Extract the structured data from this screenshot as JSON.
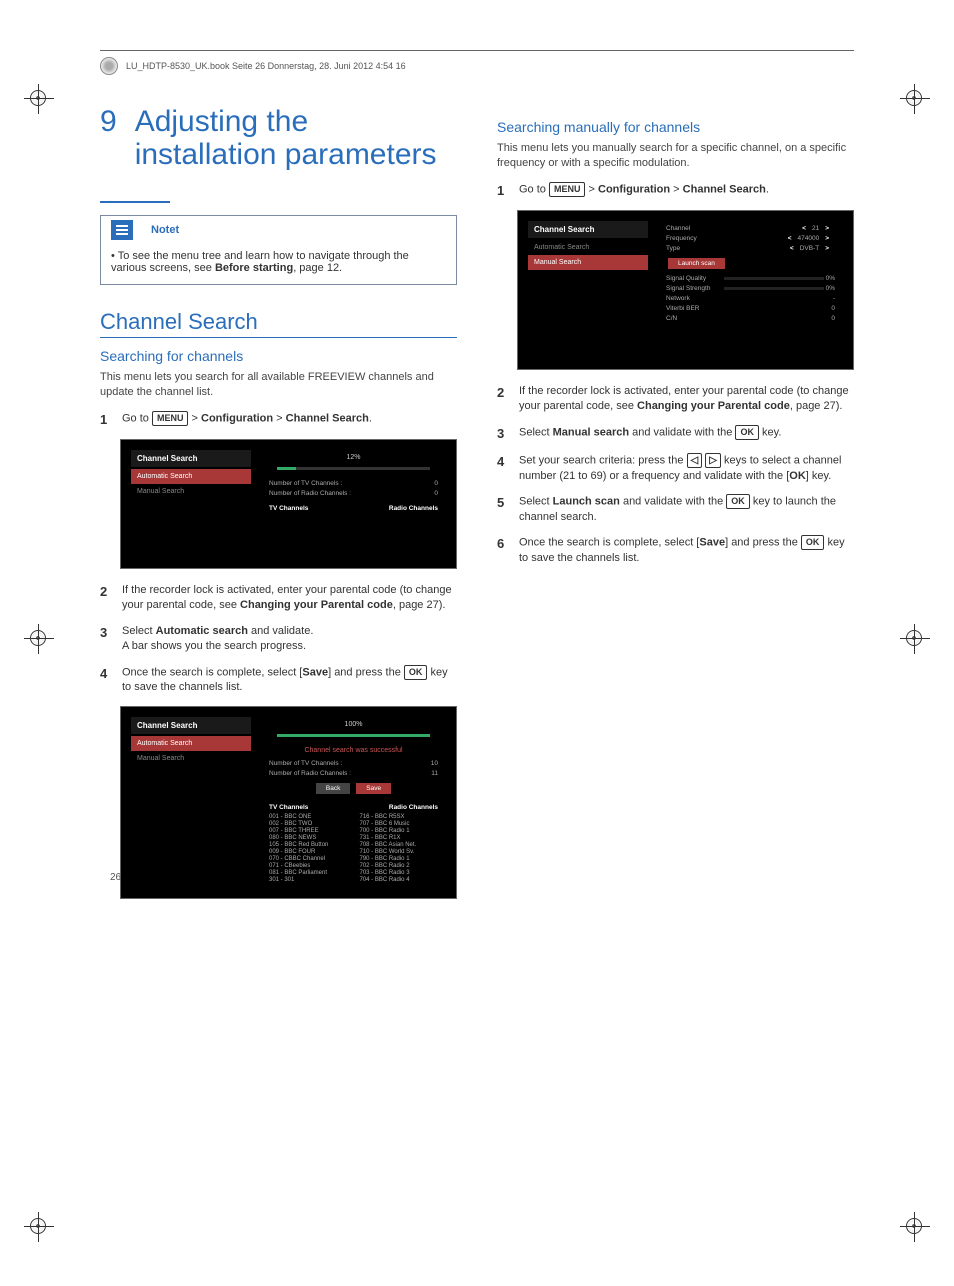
{
  "header": {
    "file_info": "LU_HDTP-8530_UK.book  Seite 26  Donnerstag, 28. Juni 2012  4:54 16"
  },
  "chapter": {
    "number": "9",
    "title": "Adjusting the installation parameters"
  },
  "note": {
    "label": "Notet",
    "text_pre": "• To see the menu tree and learn how to navigate through the various screens, see ",
    "text_bold": "Before starting",
    "text_post": ", page 12."
  },
  "left": {
    "h2": "Channel Search",
    "h3": "Searching for channels",
    "intro": "This menu lets you search for all available FREEVIEW channels and update the channel list.",
    "step1_pre": "Go to ",
    "menu": "MENU",
    "step1_mid": " > ",
    "step1_b1": "Configuration",
    "step1_mid2": " > ",
    "step1_b2": "Channel Search",
    "step1_end": ".",
    "step2_pre": "If the recorder lock is activated, enter your parental code (to change your parental code, see ",
    "step2_bold": "Changing your Parental code",
    "step2_post": ", page 27).",
    "step3_pre": "Select ",
    "step3_bold": "Automatic search",
    "step3_post": " and validate.",
    "step3_line2": "A bar shows you the search progress.",
    "step4_pre": "Once the search is complete, select [",
    "step4_bold": "Save",
    "step4_post": "] and press the ",
    "ok": "OK",
    "step4_end": " key to save the channels list."
  },
  "right": {
    "h3": "Searching manually for channels",
    "intro": "This menu lets you manually search for a specific channel, on a specific frequency or with a specific modulation.",
    "step1_pre": "Go to ",
    "menu": "MENU",
    "step1_mid": " > ",
    "step1_b1": "Configuration",
    "step1_mid2": " > ",
    "step1_b2": "Channel Search",
    "step1_end": ".",
    "step2_pre": "If the recorder lock is activated, enter your parental code (to change your parental code, see ",
    "step2_bold": "Changing your Parental code",
    "step2_post": ", page 27).",
    "step3_pre": "Select ",
    "step3_bold": "Manual search",
    "step3_post": " and validate with the ",
    "ok": "OK",
    "step3_end": " key.",
    "step4_pre": "Set your search criteria: press the ",
    "left_key": "◁",
    "right_key": "▷",
    "step4_mid": " keys to select a channel number (21 to 69) or a frequency and validate with the [",
    "step4_bold": "OK",
    "step4_end": "] key.",
    "step5_pre": "Select ",
    "step5_bold": "Launch scan",
    "step5_post": " and validate with the ",
    "step5_end": " key to launch the channel search.",
    "step6_pre": "Once the search is complete, select [",
    "step6_bold": "Save",
    "step6_post": "] and press the ",
    "step6_end": " key to save the channels list."
  },
  "screens": {
    "s1": {
      "title": "Channel Search",
      "auto": "Automatic Search",
      "manual": "Manual Search",
      "progress": "12%",
      "tv_label": "Number of TV Channels :",
      "tv_n": "0",
      "radio_label": "Number of Radio Channels :",
      "radio_n": "0",
      "col_tv": "TV Channels",
      "col_radio": "Radio Channels"
    },
    "s2": {
      "title": "Channel Search",
      "auto": "Automatic Search",
      "manual": "Manual Search",
      "progress": "100%",
      "success": "Channel search was successful",
      "tv_label": "Number of TV Channels :",
      "tv_n": "10",
      "radio_label": "Number of Radio Channels :",
      "radio_n": "11",
      "back": "Back",
      "save": "Save",
      "col_tv": "TV Channels",
      "col_radio": "Radio Channels",
      "tv_list": [
        "001 - BBC ONE",
        "002 - BBC TWO",
        "007 - BBC THREE",
        "080 - BBC NEWS",
        "105 - BBC Red Button",
        "009 - BBC FOUR",
        "070 - CBBC Channel",
        "071 - CBeebies",
        "081 - BBC Parliament",
        "301 - 301"
      ],
      "radio_list": [
        "716 - BBC R5SX",
        "707 - BBC 6 Music",
        "700 - BBC Radio 1",
        "731 - BBC R1X",
        "708 - BBC Asian Net.",
        "710 - BBC World Sv.",
        "790 - BBC Radio 1",
        "702 - BBC Radio 2",
        "703 - BBC Radio 3",
        "704 - BBC Radio 4"
      ]
    },
    "s3": {
      "title": "Channel Search",
      "auto": "Automatic Search",
      "manual": "Manual Search",
      "channel": "Channel",
      "channel_v": "21",
      "freq": "Frequency",
      "freq_v": "474000",
      "type": "Type",
      "type_v": "DVB-T",
      "launch": "Launch scan",
      "sq": "Signal Quality",
      "sq_v": "0%",
      "ss": "Signal Strength",
      "ss_v": "0%",
      "net": "Network",
      "net_v": "-",
      "vber": "Viterbi BER",
      "vber_v": "0",
      "cn": "C/N",
      "cn_v": "0"
    }
  },
  "page_number": "26"
}
